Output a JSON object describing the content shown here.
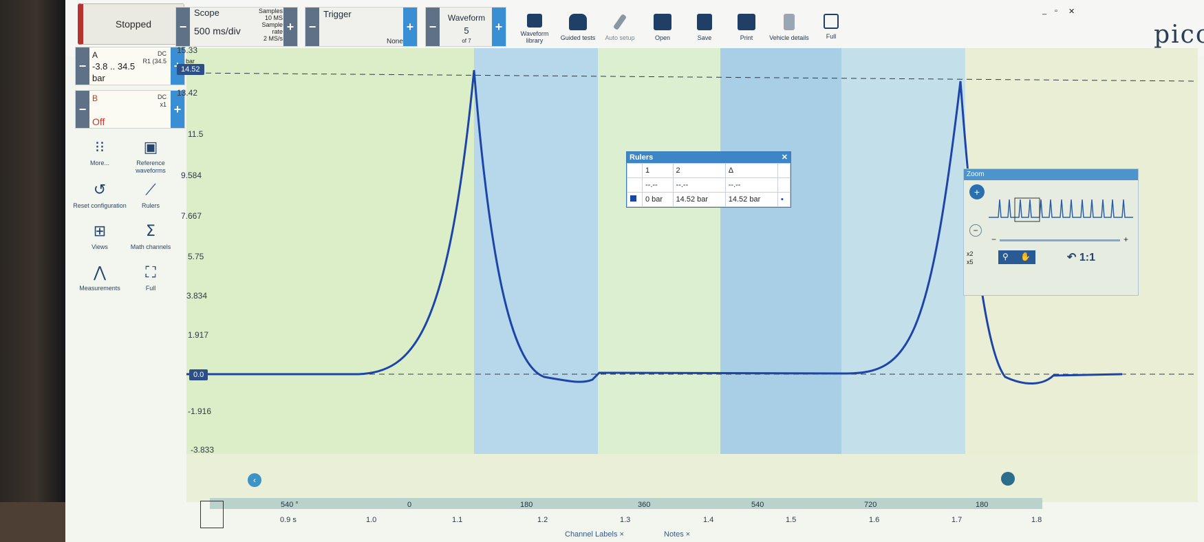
{
  "run_state": {
    "label": "Stopped"
  },
  "scope": {
    "title": "Scope",
    "timebase": "500 ms/div",
    "samples_label": "Samples",
    "samples_value": "10 MS",
    "sample_rate_label": "Sample rate",
    "sample_rate_value": "2 MS/s"
  },
  "trigger": {
    "title": "Trigger",
    "mode": "None"
  },
  "waveform": {
    "title": "Waveform",
    "index": "5",
    "of": "of 7"
  },
  "toolbar": [
    {
      "label": "Waveform library"
    },
    {
      "label": "Guided tests"
    },
    {
      "label": "Auto setup"
    },
    {
      "label": "Open"
    },
    {
      "label": "Save"
    },
    {
      "label": "Print"
    },
    {
      "label": "Vehicle details"
    },
    {
      "label": "Full"
    }
  ],
  "brand": "picc",
  "channel_a": {
    "name": "A",
    "coupling": "DC",
    "probe": "R1 (34.5",
    "range": "-3.8 .. 34.5",
    "unit": "bar"
  },
  "channel_b": {
    "name": "B",
    "coupling": "DC",
    "probe": "x1",
    "state": "Off"
  },
  "left_tools": [
    {
      "label": "More...",
      "icon": "grid-icon"
    },
    {
      "label": "Reference waveforms",
      "icon": "reference-waveforms-icon"
    },
    {
      "label": "Reset configuration",
      "icon": "reset-icon"
    },
    {
      "label": "Rulers",
      "icon": "ruler-icon"
    },
    {
      "label": "Views",
      "icon": "views-icon"
    },
    {
      "label": "Math channels",
      "icon": "sigma-icon"
    },
    {
      "label": "Measurements",
      "icon": "measurements-icon"
    },
    {
      "label": "Full",
      "icon": "fullscreen-icon"
    }
  ],
  "y_axis_labels": [
    "15.33",
    "13.42",
    "11.5",
    "9.584",
    "7.667",
    "5.75",
    "3.834",
    "1.917",
    "0.0",
    "-1.916",
    "-3.833"
  ],
  "y_marker": "14.52",
  "y_unit": "bar",
  "x_axis_labels": [
    "0.9 s",
    "1.0",
    "1.1",
    "1.2",
    "1.3",
    "1.4",
    "1.5",
    "1.6",
    "1.7",
    "1.8"
  ],
  "degree_labels": [
    "540 °",
    "0",
    "180",
    "360",
    "540",
    "720",
    "180"
  ],
  "rulers": {
    "title": "Rulers",
    "col1": "1",
    "col2": "2",
    "col3": "Δ",
    "r1c1": "--.--",
    "r1c2": "--.--",
    "r1c3": "--.--",
    "r2c1": "0 bar",
    "r2c2": "14.52 bar",
    "r2c3": "14.52 bar"
  },
  "zoom": {
    "title": "Zoom",
    "ratio": "1:1",
    "x2": "x2",
    "x5": "x5"
  },
  "footer": {
    "channel_labels": "Channel Labels",
    "notes": "Notes"
  }
}
